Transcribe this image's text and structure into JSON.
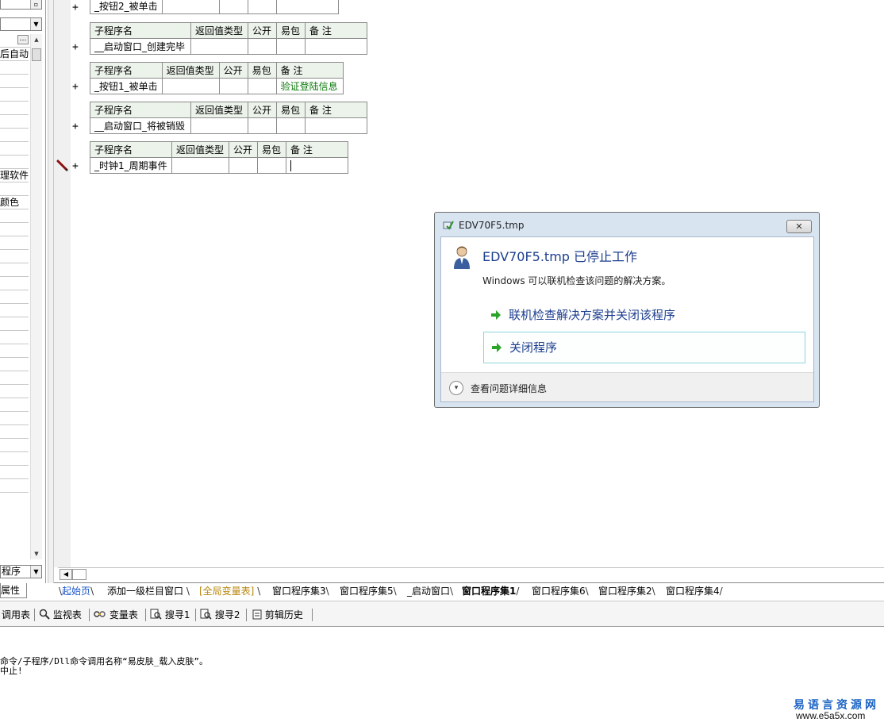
{
  "left_panel": {
    "combo_top": "",
    "combo_second": "",
    "row_auto": "后自动",
    "row_software": "理软件",
    "row_color": "颜色",
    "combo_bottom": "程序",
    "tab_label": "属性"
  },
  "routine_table": {
    "headers": [
      "子程序名",
      "返回值类型",
      "公开",
      "易包",
      "备 注"
    ]
  },
  "routines": [
    {
      "name": "_按钮2_被单击",
      "note": ""
    },
    {
      "name": "__启动窗口_创建完毕",
      "note": ""
    },
    {
      "name": "_按钮1_被单击",
      "note": "验证登陆信息"
    },
    {
      "name": "__启动窗口_将被销毁",
      "note": ""
    },
    {
      "name": "_时钟1_周期事件",
      "note": ""
    }
  ],
  "editor_tabs": [
    {
      "label": "起始页",
      "state": "first"
    },
    {
      "label": "添加一级栏目窗口",
      "state": "normal"
    },
    {
      "label": "[全局变量表]",
      "state": "global"
    },
    {
      "label": "窗口程序集3",
      "state": "normal"
    },
    {
      "label": "窗口程序集5",
      "state": "normal"
    },
    {
      "label": "_启动窗口",
      "state": "normal"
    },
    {
      "label": "窗口程序集1",
      "state": "active"
    },
    {
      "label": "窗口程序集6",
      "state": "normal"
    },
    {
      "label": "窗口程序集2",
      "state": "normal"
    },
    {
      "label": "窗口程序集4",
      "state": "normal"
    }
  ],
  "toolbar": [
    {
      "label": "调用表",
      "icon": ""
    },
    {
      "label": "监视表",
      "icon": "magnifier-icon"
    },
    {
      "label": "变量表",
      "icon": "variables-icon"
    },
    {
      "label": "搜寻1",
      "icon": "search-doc-icon"
    },
    {
      "label": "搜寻2",
      "icon": "search-doc-icon"
    },
    {
      "label": "剪辑历史",
      "icon": "clipboard-icon"
    }
  ],
  "output": {
    "line1": "命令/子程序/Dll命令调用名称“易皮肤_载入皮肤”。",
    "line2": "中止!"
  },
  "watermark": {
    "name": "易语言资源网",
    "url": "www.e5a5x.com"
  },
  "dialog": {
    "title": "EDV70F5.tmp",
    "close_label": "✕",
    "heading": "EDV70F5.tmp 已停止工作",
    "description": "Windows 可以联机检查该问题的解决方案。",
    "option_check_online": "联机检查解决方案并关闭该程序",
    "option_close": "关闭程序",
    "details_label": "查看问题详细信息"
  },
  "colors": {
    "header_bg": "#ecf3ea",
    "note_green": "#0a7a0a",
    "dialog_heading_blue": "#1e3f8f",
    "watermark_blue": "#1c63c4"
  }
}
